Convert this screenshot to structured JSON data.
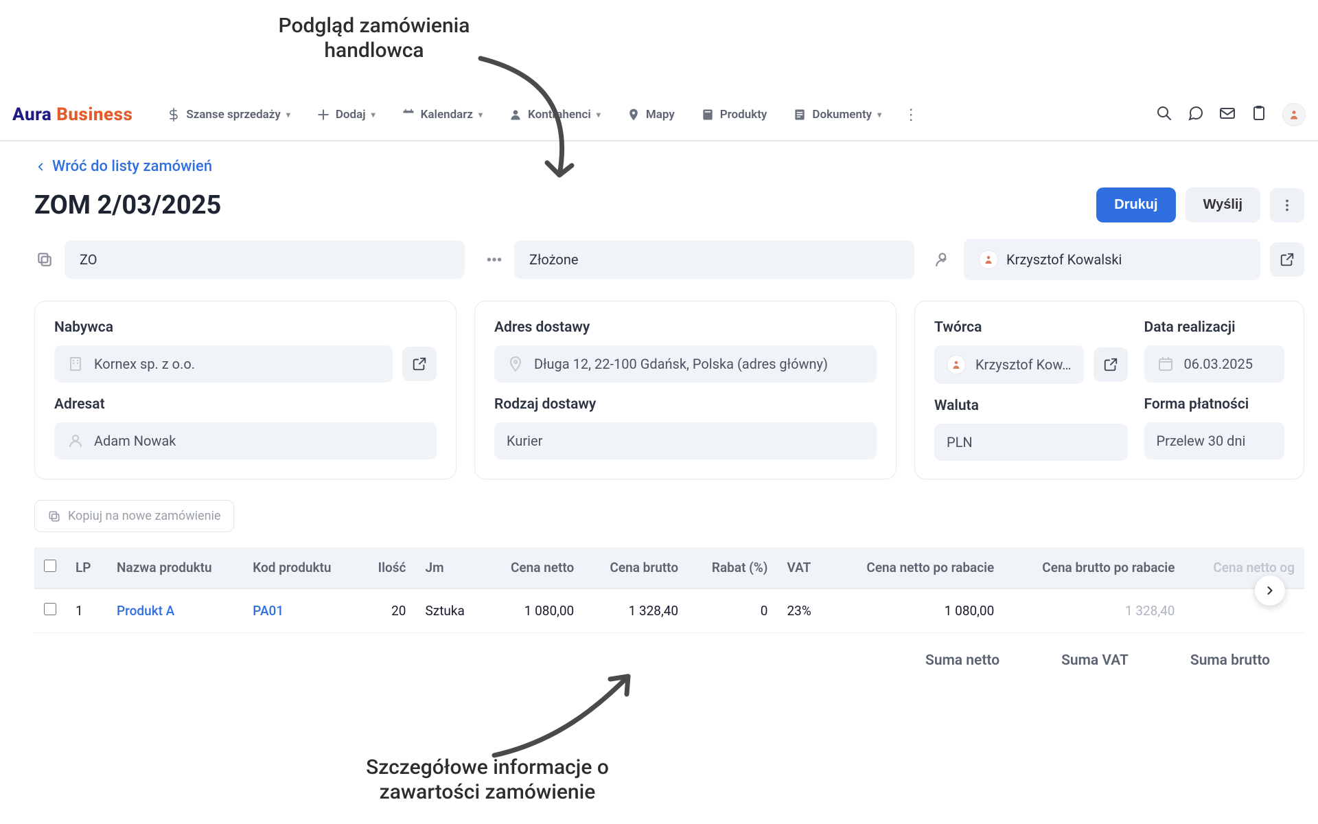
{
  "annotations": {
    "top": "Podgląd zamówienia handlowca",
    "bottom": "Szczegółowe informacje o zawartości zamówienie"
  },
  "brand": {
    "part1": "Aura",
    "part2": "Business"
  },
  "nav": {
    "items": [
      {
        "label": "Szanse sprzedaży",
        "hasChevron": true
      },
      {
        "label": "Dodaj",
        "hasChevron": true
      },
      {
        "label": "Kalendarz",
        "hasChevron": true
      },
      {
        "label": "Kontrahenci",
        "hasChevron": true
      },
      {
        "label": "Mapy",
        "hasChevron": false
      },
      {
        "label": "Produkty",
        "hasChevron": false
      },
      {
        "label": "Dokumenty",
        "hasChevron": true
      }
    ]
  },
  "page": {
    "backlink": "Wróć do listy zamówień",
    "title": "ZOM 2/03/2025",
    "actions": {
      "print": "Drukuj",
      "send": "Wyślij"
    },
    "meta": {
      "doc_type": "ZO",
      "status": "Złożone",
      "assignee": "Krzysztof Kowalski"
    }
  },
  "buyer": {
    "label_buyer": "Nabywca",
    "buyer": "Kornex sp. z o.o.",
    "label_addressee": "Adresat",
    "addressee": "Adam Nowak"
  },
  "delivery": {
    "label_addr": "Adres dostawy",
    "address": "Długa 12, 22-100 Gdańsk, Polska (adres główny)",
    "label_kind": "Rodzaj dostawy",
    "kind": "Kurier"
  },
  "meta2": {
    "label_creator": "Twórca",
    "creator": "Krzysztof Kow…",
    "label_date": "Data realizacji",
    "date": "06.03.2025",
    "label_currency": "Waluta",
    "currency": "PLN",
    "label_payment": "Forma płatności",
    "payment": "Przelew 30 dni"
  },
  "products": {
    "copy_label": "Kopiuj na nowe zamówienie",
    "headers": {
      "lp": "LP",
      "name": "Nazwa produktu",
      "code": "Kod produktu",
      "qty": "Ilość",
      "unit": "Jm",
      "netto": "Cena netto",
      "brutto": "Cena brutto",
      "rabat": "Rabat (%)",
      "vat": "VAT",
      "netto_after": "Cena netto po rabacie",
      "brutto_after": "Cena brutto po rabacie",
      "overflow": "Cena netto og"
    },
    "rows": [
      {
        "lp": "1",
        "name": "Produkt A",
        "code": "PA01",
        "qty": "20",
        "unit": "Sztuka",
        "netto": "1 080,00",
        "brutto": "1 328,40",
        "rabat": "0",
        "vat": "23%",
        "netto_after": "1 080,00",
        "brutto_after": "1 328,40"
      }
    ],
    "totals": {
      "suma_netto": "Suma netto",
      "suma_vat": "Suma VAT",
      "suma_brutto": "Suma brutto"
    }
  }
}
